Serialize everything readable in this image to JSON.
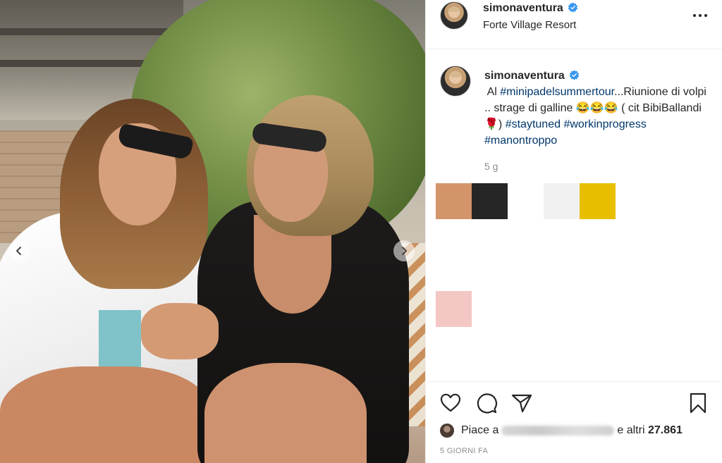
{
  "post": {
    "username": "simonaventura",
    "location": "Forte Village Resort",
    "caption": {
      "intro": " Al ",
      "tag1": "#minipadelsummertour",
      "text1": "...Riunione di volpi .. strage di galline 😂😂😂 ( cit BibiBallandi 🌹) ",
      "tag2": "#staytuned",
      "tag3": "#workinprogress",
      "tag4": "#manontroppo"
    },
    "caption_time": "5 g",
    "likes": {
      "prefix": "Piace a",
      "middle": "e altri",
      "count": "27.861"
    },
    "post_age": "5 GIORNI FA"
  },
  "swatches": [
    {
      "name": "tan-swatch",
      "color": "#d4946a"
    },
    {
      "name": "black-swatch",
      "color": "#262626"
    },
    {
      "name": "light-gray-swatch",
      "color": "#f1f1f1"
    },
    {
      "name": "yellow-swatch",
      "color": "#e8bf00"
    },
    {
      "name": "pink-swatch",
      "color": "#f3c8c4"
    }
  ],
  "colors": {
    "verified_blue": "#3897f0",
    "hashtag_blue": "#00376b",
    "secondary_text": "#8e8e8e"
  },
  "icons": {
    "carousel_prev": "chevron-left-icon",
    "carousel_next": "chevron-right-icon",
    "more": "more-horizontal-icon",
    "like": "heart-icon",
    "comment": "comment-icon",
    "share": "paper-plane-icon",
    "save": "bookmark-icon"
  }
}
